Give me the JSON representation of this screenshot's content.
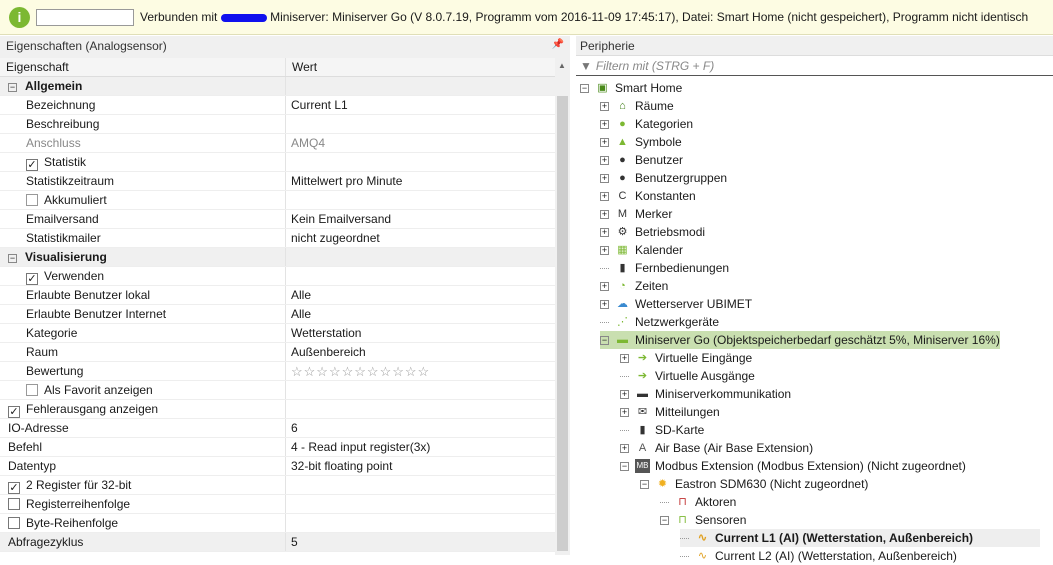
{
  "topbar": {
    "status_pre": "Verbunden mit",
    "status_post": "Miniserver: Miniserver Go (V 8.0.7.19, Programm vom 2016-11-09 17:45:17), Datei: Smart Home (nicht gespeichert), Programm nicht identisch",
    "info_icon": "i"
  },
  "properties": {
    "title": "Eigenschaften (Analogsensor)",
    "col1": "Eigenschaft",
    "col2": "Wert",
    "rows": [
      {
        "k": "Allgemein",
        "type": "cat"
      },
      {
        "k": "Bezeichnung",
        "v": "Current L1",
        "i": 1
      },
      {
        "k": "Beschreibung",
        "v": "",
        "i": 1
      },
      {
        "k": "Anschluss",
        "v": "AMQ4",
        "i": 1,
        "dim": true
      },
      {
        "k": "Statistik",
        "cb": true,
        "checked": true,
        "i": 1
      },
      {
        "k": "Statistikzeitraum",
        "v": "Mittelwert pro Minute",
        "i": 1
      },
      {
        "k": "Akkumuliert",
        "cb": true,
        "checked": false,
        "i": 2
      },
      {
        "k": "Emailversand",
        "v": "Kein Emailversand",
        "i": 1
      },
      {
        "k": "Statistikmailer",
        "v": "nicht zugeordnet",
        "i": 1
      },
      {
        "k": "Visualisierung",
        "type": "cat"
      },
      {
        "k": "Verwenden",
        "cb": true,
        "checked": true,
        "i": 1
      },
      {
        "k": "Erlaubte Benutzer lokal",
        "v": "Alle",
        "i": 1
      },
      {
        "k": "Erlaubte Benutzer Internet",
        "v": "Alle",
        "i": 1
      },
      {
        "k": "Kategorie",
        "v": "Wetterstation",
        "i": 1
      },
      {
        "k": "Raum",
        "v": "Außenbereich",
        "i": 1
      },
      {
        "k": "Bewertung",
        "v": "☆☆☆☆☆☆☆☆☆☆☆",
        "stars": true,
        "i": 1
      },
      {
        "k": "Als Favorit anzeigen",
        "cb": true,
        "checked": false,
        "i": 2
      },
      {
        "k": "Fehlerausgang anzeigen",
        "cb": true,
        "checked": true,
        "i": 0
      },
      {
        "k": "IO-Adresse",
        "v": "6",
        "i": 0
      },
      {
        "k": "Befehl",
        "v": "4 - Read input register(3x)",
        "i": 0
      },
      {
        "k": "Datentyp",
        "v": "32-bit floating point",
        "i": 0
      },
      {
        "k": "2 Register für 32-bit",
        "cb": true,
        "checked": true,
        "i": 0
      },
      {
        "k": "Registerreihenfolge",
        "cb": true,
        "checked": false,
        "i": 0
      },
      {
        "k": "Byte-Reihenfolge",
        "cb": true,
        "checked": false,
        "i": 0
      },
      {
        "k": "Abfragezyklus",
        "v": "5",
        "i": 0,
        "shade": true
      }
    ]
  },
  "periphery": {
    "title": "Peripherie",
    "filter_placeholder": "Filtern mit (STRG + F)",
    "tree": [
      {
        "label": "Smart Home",
        "lvl": 0,
        "exp": "-",
        "icon": "▣",
        "color": "#4a8a1a"
      },
      {
        "label": "Räume",
        "lvl": 1,
        "exp": "+",
        "icon": "⌂",
        "color": "#3a7a10"
      },
      {
        "label": "Kategorien",
        "lvl": 1,
        "exp": "+",
        "icon": "●",
        "color": "#7cb832"
      },
      {
        "label": "Symbole",
        "lvl": 1,
        "exp": "+",
        "icon": "▲",
        "color": "#7cb832"
      },
      {
        "label": "Benutzer",
        "lvl": 1,
        "exp": "+",
        "icon": "●",
        "color": "#333"
      },
      {
        "label": "Benutzergruppen",
        "lvl": 1,
        "exp": "+",
        "icon": "●",
        "color": "#333"
      },
      {
        "label": "Konstanten",
        "lvl": 1,
        "exp": "+",
        "icon": "C",
        "color": "#333"
      },
      {
        "label": "Merker",
        "lvl": 1,
        "exp": "+",
        "icon": "M",
        "color": "#333"
      },
      {
        "label": "Betriebsmodi",
        "lvl": 1,
        "exp": "+",
        "icon": "⚙",
        "color": "#333"
      },
      {
        "label": "Kalender",
        "lvl": 1,
        "exp": "+",
        "icon": "▦",
        "color": "#7cb832"
      },
      {
        "label": "Fernbedienungen",
        "lvl": 1,
        "exp": "",
        "icon": "▮",
        "color": "#333"
      },
      {
        "label": "Zeiten",
        "lvl": 1,
        "exp": "+",
        "icon": "◔",
        "color": "#7cb832"
      },
      {
        "label": "Wetterserver UBIMET",
        "lvl": 1,
        "exp": "+",
        "icon": "☁",
        "color": "#3a8ad0"
      },
      {
        "label": "Netzwerkgeräte",
        "lvl": 1,
        "exp": "",
        "icon": "⋰",
        "color": "#7cb832"
      },
      {
        "label": "Miniserver Go (Objektspeicherbedarf geschätzt 5%, Miniserver 16%)",
        "lvl": 1,
        "exp": "-",
        "icon": "▬",
        "color": "#7cb832",
        "sel": true
      },
      {
        "label": "Virtuelle Eingänge",
        "lvl": 2,
        "exp": "+",
        "icon": "➔",
        "color": "#7cb832"
      },
      {
        "label": "Virtuelle Ausgänge",
        "lvl": 2,
        "exp": "",
        "icon": "➔",
        "color": "#7cb832"
      },
      {
        "label": "Miniserverkommunikation",
        "lvl": 2,
        "exp": "+",
        "icon": "▬",
        "color": "#333"
      },
      {
        "label": "Mitteilungen",
        "lvl": 2,
        "exp": "+",
        "icon": "✉",
        "color": "#333"
      },
      {
        "label": "SD-Karte",
        "lvl": 2,
        "exp": "",
        "icon": "▮",
        "color": "#333"
      },
      {
        "label": "Air Base (Air Base Extension)",
        "lvl": 2,
        "exp": "+",
        "icon": "A",
        "color": "#555"
      },
      {
        "label": "Modbus Extension (Modbus Extension) (Nicht zugeordnet)",
        "lvl": 2,
        "exp": "-",
        "icon": "MB",
        "color": "#555"
      },
      {
        "label": "Eastron SDM630 (Nicht zugeordnet)",
        "lvl": 3,
        "exp": "-",
        "icon": "✹",
        "color": "#f0b020"
      },
      {
        "label": "Aktoren",
        "lvl": 4,
        "exp": "",
        "icon": "⊓",
        "color": "#c03030"
      },
      {
        "label": "Sensoren",
        "lvl": 4,
        "exp": "-",
        "icon": "⊓",
        "color": "#7cb832"
      },
      {
        "label": "Current L1 (AI) (Wetterstation, Außenbereich)",
        "lvl": 5,
        "exp": "",
        "icon": "∿",
        "color": "#e0a020",
        "cur": true
      },
      {
        "label": "Current L2 (AI) (Wetterstation, Außenbereich)",
        "lvl": 5,
        "exp": "",
        "icon": "∿",
        "color": "#e0a020"
      }
    ]
  }
}
